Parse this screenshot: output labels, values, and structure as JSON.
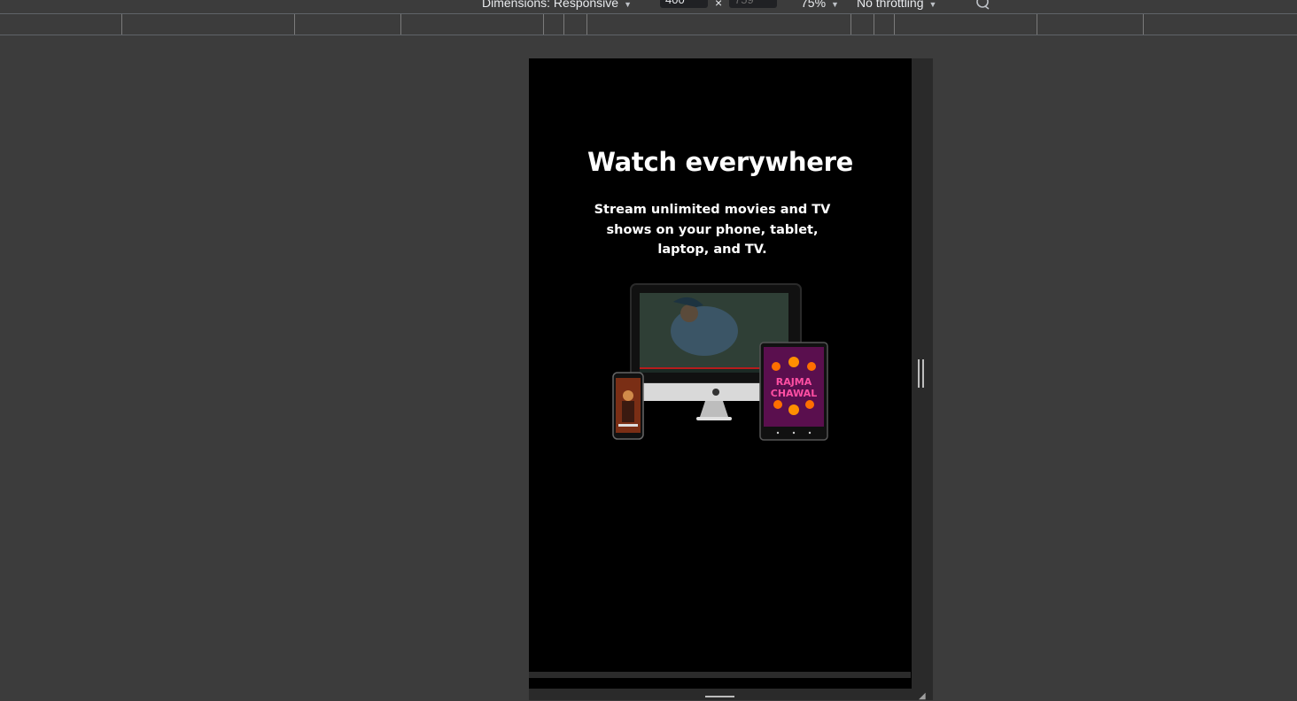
{
  "toolbar": {
    "dimensions_label": "Dimensions: Responsive",
    "width_value": "400",
    "height_value": "759",
    "times": "×",
    "zoom_label": "75%",
    "throttle_label": "No throttling",
    "rotate_icon": "rotate-icon"
  },
  "page": {
    "headline": "Watch everywhere",
    "subtext": "Stream unlimited movies and TV shows on your phone, tablet, laptop, and TV.",
    "devices_image": "devices-image",
    "tablet_poster_text": "RAJMA CHAWAL"
  },
  "colors": {
    "page_background": "#000000",
    "devtools_background": "#3c3c3c",
    "text": "#ffffff"
  }
}
